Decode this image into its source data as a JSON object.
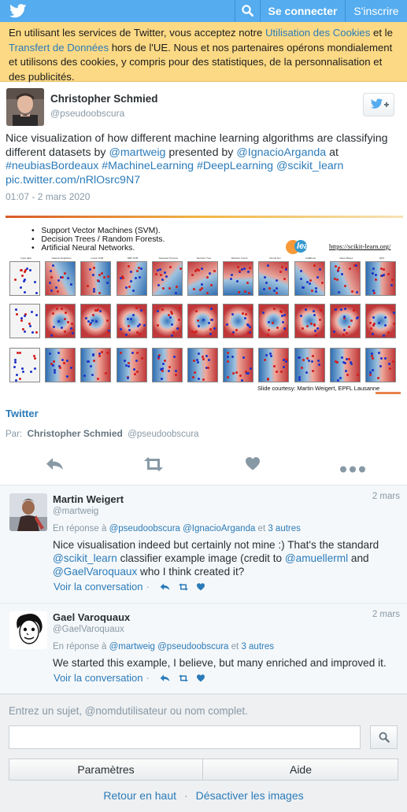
{
  "topbar": {
    "connect_label": "Se connecter",
    "signup_label": "S'inscrire",
    "accent": "#55acee"
  },
  "cookie": {
    "t1": "En utilisant les services de Twitter, vous acceptez notre ",
    "link1": "Utilisation des Cookies",
    "t2": " et le ",
    "link2": "Transfert de Données",
    "t3": " hors de l'UE. Nous et nos partenaires opérons mondialement et utilisons des cookies, y compris pour des statistiques, de la personnalisation et des publicités.",
    "bg": "#fcd984"
  },
  "tweet": {
    "name": "Christopher Schmied",
    "handle": "@pseudoobscura",
    "text_1": "Nice visualization of how different machine learning algorithms are classifying different datasets by ",
    "mention_1": "@martweig",
    "text_2": " presented by ",
    "mention_2": "@IgnacioArganda",
    "text_3": " at ",
    "hashtag_1": "#neubiasBordeaux",
    "hashtag_2": "#MachineLearning",
    "hashtag_3": "#DeepLearning",
    "mention_3": "@scikit_learn",
    "pic_link": "pic.twitter.com/nRlOsrc9N7",
    "time": "01:07 - 2 mars 2020",
    "media": {
      "bullet_1": "Support Vector Machines (SVM).",
      "bullet_2": "Decision Trees / Random Forests.",
      "bullet_3": "Artificial Neural Networks.",
      "logo_text": "learn",
      "url": "https://scikit-learn.org/",
      "credit": "Slide courtesy: Martin Weigert, EPFL Lausanne",
      "columns": [
        "Input data",
        "Nearest Neighbors",
        "Linear SVM",
        "RBF SVM",
        "Gaussian Process",
        "Decision Tree",
        "Random Forest",
        "Neural Net",
        "AdaBoost",
        "Naive Bayes",
        "QDA"
      ]
    },
    "source": "Twitter",
    "par_label": "Par:",
    "par_name": "Christopher Schmied",
    "par_handle": "@pseudoobscura"
  },
  "replies": [
    {
      "name": "Martin Weigert",
      "handle": "@martweig",
      "date": "2 mars",
      "reply_prefix": "En réponse à ",
      "reply_to": "@pseudoobscura @IgnacioArganda",
      "reply_and": " et ",
      "reply_others": "3 autres",
      "text_1": "Nice visualisation indeed but certainly not mine :) That's the standard ",
      "mention_1": "@scikit_learn",
      "text_2": " classifier example image (credit to ",
      "mention_2": "@amuellerml",
      "text_3": " and ",
      "mention_3": "@GaelVaroquaux",
      "text_4": " who I think created it?",
      "view": "Voir la conversation",
      "dot": "·"
    },
    {
      "name": "Gael Varoquaux",
      "handle": "@GaelVaroquaux",
      "date": "2 mars",
      "reply_prefix": "En réponse à ",
      "reply_to": "@martweig @pseudoobscura",
      "reply_and": " et ",
      "reply_others": "3 autres",
      "text_1": "We started this example, I believe, but many enriched and improved it.",
      "view": "Voir la conversation",
      "dot": "·"
    }
  ],
  "search": {
    "label": "Entrez un sujet, @nomdutilisateur ou nom complet.",
    "value": "",
    "settings": "Paramètres",
    "help": "Aide",
    "back_top": "Retour en haut",
    "sep": "·",
    "disable_images": "Désactiver les images"
  }
}
